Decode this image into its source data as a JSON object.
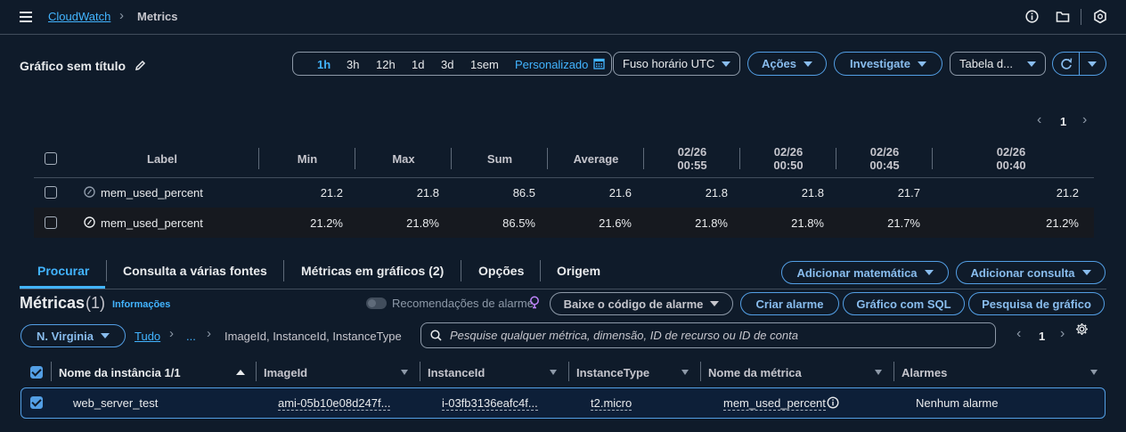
{
  "breadcrumb": {
    "root": "CloudWatch",
    "current": "Metrics"
  },
  "graph": {
    "title": "Gráfico sem título"
  },
  "time_range": {
    "options": [
      "1h",
      "3h",
      "12h",
      "1d",
      "3d",
      "1sem"
    ],
    "selected": "1h",
    "custom": "Personalizado"
  },
  "toolbar": {
    "timezone": "Fuso horário UTC",
    "actions": "Ações",
    "investigate": "Investigate",
    "view": "Tabela d..."
  },
  "pagination_top": {
    "page": "1"
  },
  "table": {
    "headers": {
      "label": "Label",
      "min": "Min",
      "max": "Max",
      "sum": "Sum",
      "average": "Average",
      "t1d": "02/26",
      "t1t": "00:55",
      "t2d": "02/26",
      "t2t": "00:50",
      "t3d": "02/26",
      "t3t": "00:45",
      "t4d": "02/26",
      "t4t": "00:40"
    },
    "rows": [
      {
        "label": "mem_used_percent",
        "min": "21.2",
        "max": "21.8",
        "sum": "86.5",
        "avg": "21.6",
        "v1": "21.8",
        "v2": "21.8",
        "v3": "21.7",
        "v4": "21.2"
      },
      {
        "label": "mem_used_percent",
        "min": "21.2%",
        "max": "21.8%",
        "sum": "86.5%",
        "avg": "21.6%",
        "v1": "21.8%",
        "v2": "21.8%",
        "v3": "21.7%",
        "v4": "21.2%"
      }
    ]
  },
  "tabs": [
    "Procurar",
    "Consulta a várias fontes",
    "Métricas em gráficos (2)",
    "Opções",
    "Origem"
  ],
  "tab_actions": {
    "add_math": "Adicionar matemática",
    "add_query": "Adicionar consulta"
  },
  "metrics": {
    "title": "Métricas",
    "count": "(1)",
    "info": "Informações",
    "alarm_recs": "Recomendações de alarme",
    "download_alarm_code": "Baixe o código de alarme",
    "create_alarm": "Criar alarme",
    "graph_sql": "Gráfico com SQL",
    "graph_search": "Pesquisa de gráfico"
  },
  "filter": {
    "region": "N. Virginia",
    "all": "Tudo",
    "ellipsis": "...",
    "dimensions": "ImageId, InstanceId, InstanceType",
    "search_placeholder": "Pesquise qualquer métrica, dimensão, ID de recurso ou ID de conta",
    "page": "1"
  },
  "results": {
    "headers": {
      "name": "Nome da instância 1/1",
      "image": "ImageId",
      "instance": "InstanceId",
      "type": "InstanceType",
      "metric": "Nome da métrica",
      "alarms": "Alarmes"
    },
    "row": {
      "name": "web_server_test",
      "image": "ami-05b10e08d247f...",
      "instance": "i-03fb3136eafc4f...",
      "type": "t2.micro",
      "metric": "mem_used_percent",
      "alarms": "Nenhum alarme"
    }
  }
}
